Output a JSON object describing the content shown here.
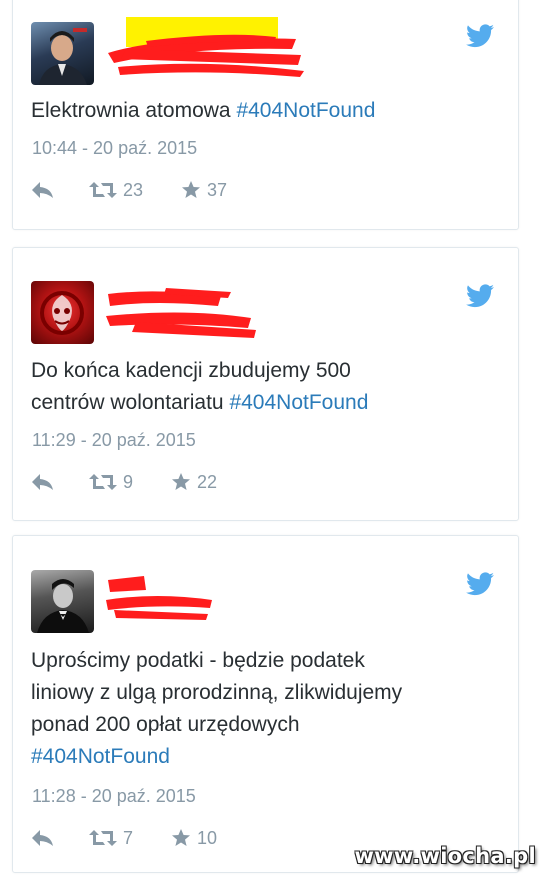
{
  "colors": {
    "accent": "#55acee",
    "hashtag": "#2b7bb9",
    "meta": "#8899a6",
    "text": "#292f33",
    "redact": "#ff1d1d",
    "highlight": "#fff200"
  },
  "tweets": [
    {
      "avatar_icon": "man-in-suit-avatar",
      "text": "Elektrownia atomowa ",
      "hashtag": "#404NotFound",
      "time": "10:44 - 20 paź. 2015",
      "retweets": "23",
      "likes": "37"
    },
    {
      "avatar_icon": "red-emblem-avatar",
      "text": "Do końca kadencji zbudujemy 500\ncentrów wolontariatu ",
      "hashtag": "#404NotFound",
      "time": "11:29 - 20 paź. 2015",
      "retweets": "9",
      "likes": "22"
    },
    {
      "avatar_icon": "man-portrait-avatar",
      "text": "Uprościmy podatki - będzie podatek\nliniowy z ulgą prorodzinną, zlikwidujemy\nponad 200 opłat urzędowych\n",
      "hashtag": "#404NotFound",
      "time": "11:28 - 20 paź. 2015",
      "retweets": "7",
      "likes": "10"
    }
  ],
  "icons": {
    "reply": "reply-icon",
    "retweet": "retweet-icon",
    "like": "star-icon",
    "brand": "twitter-bird-icon"
  },
  "watermark": "www.wiocha.pl"
}
